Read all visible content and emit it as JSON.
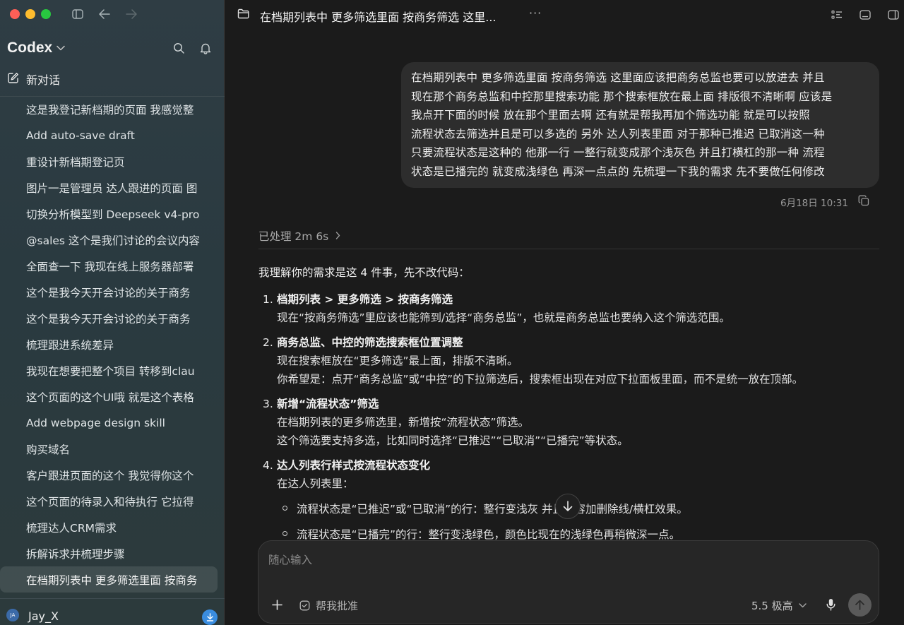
{
  "app": {
    "name": "Codex",
    "new_chat_label": "新对话",
    "user_initials": "JA",
    "user_name": "Jay_X"
  },
  "sidebar": {
    "conversations": [
      {
        "title": "这是我登记新档期的页面 我感觉整"
      },
      {
        "title": "Add auto-save draft"
      },
      {
        "title": "重设计新档期登记页"
      },
      {
        "title": "图片一是管理员 达人跟进的页面 图"
      },
      {
        "title": "切换分析模型到 Deepseek v4-pro"
      },
      {
        "title": "@sales 这个是我们讨论的会议内容"
      },
      {
        "title": "全面查一下 我现在线上服务器部署"
      },
      {
        "title": "这个是我今天开会讨论的关于商务"
      },
      {
        "title": "这个是我今天开会讨论的关于商务"
      },
      {
        "title": "梳理跟进系统差异"
      },
      {
        "title": "我现在想要把整个项目 转移到clau"
      },
      {
        "title": "这个页面的这个UI哦 就是这个表格"
      },
      {
        "title": "Add webpage design skill"
      },
      {
        "title": "购买域名"
      },
      {
        "title": "客户跟进页面的这个 我觉得你这个"
      },
      {
        "title": "这个页面的待录入和待执行 它拉得"
      },
      {
        "title": "梳理达人CRM需求"
      },
      {
        "title": "拆解诉求并梳理步骤"
      },
      {
        "title": "在档期列表中 更多筛选里面 按商务"
      }
    ]
  },
  "header": {
    "title": "在档期列表中 更多筛选里面 按商务筛选 这里...",
    "more_label": "···"
  },
  "user_message": {
    "lines": [
      "在档期列表中 更多筛选里面 按商务筛选  这里面应该把商务总监也要可以放进去   并且",
      "现在那个商务总监和中控那里搜索功能 那个搜索框放在最上面 排版很不清晰啊 应该是",
      "我点开下面的时候 放在那个里面去啊       还有就是帮我再加个筛选功能 就是可以按照",
      "流程状态去筛选并且是可以多选的     另外 达人列表里面 对于那种已推迟 已取消这一种",
      "只要流程状态是这种的 他那一行 一整行就变成那个浅灰色 并且打横杠的那一种   流程",
      "状态是已播完的 就变成浅绿色 再深一点点的  先梳理一下我的需求 先不要做任何修改"
    ],
    "timestamp": "6月18日 10:31"
  },
  "assistant": {
    "processed_label": "已处理 2m 6s",
    "intro": "我理解你的需求是这 4 件事，先不改代码：",
    "items": [
      {
        "num": "1.",
        "head": "档期列表 > 更多筛选 > 按商务筛选",
        "lines": [
          "现在“按商务筛选”里应该也能筛到/选择“商务总监”，也就是商务总监也要纳入这个筛选范围。"
        ]
      },
      {
        "num": "2.",
        "head": "商务总监、中控的筛选搜索框位置调整",
        "lines": [
          "现在搜索框放在“更多筛选”最上面，排版不清晰。",
          "你希望是：点开“商务总监”或“中控”的下拉筛选后，搜索框出现在对应下拉面板里面，而不是统一放在顶部。"
        ]
      },
      {
        "num": "3.",
        "head": "新增“流程状态”筛选",
        "lines": [
          "在档期列表的更多筛选里，新增按“流程状态”筛选。",
          "这个筛选要支持多选，比如同时选择“已推迟”“已取消”“已播完”等状态。"
        ]
      },
      {
        "num": "4.",
        "head": "达人列表行样式按流程状态变化",
        "lines": [
          "在达人列表里："
        ],
        "bullets": [
          "流程状态是“已推迟”或“已取消”的行：整行变浅灰    并且内容加删除线/横杠效果。",
          "流程状态是“已播完”的行：整行变浅绿色，颜色比现在的浅绿色再稍微深一点。"
        ]
      }
    ]
  },
  "composer": {
    "placeholder": "随心输入",
    "approve_label": "帮我批准",
    "model_label": "5.5 极高"
  },
  "colors": {
    "sidebar_bg": "#2f3d44",
    "main_bg": "#1b1b1b",
    "bubble_bg": "#2d2d2d",
    "accent_blue": "#3a8de0"
  }
}
